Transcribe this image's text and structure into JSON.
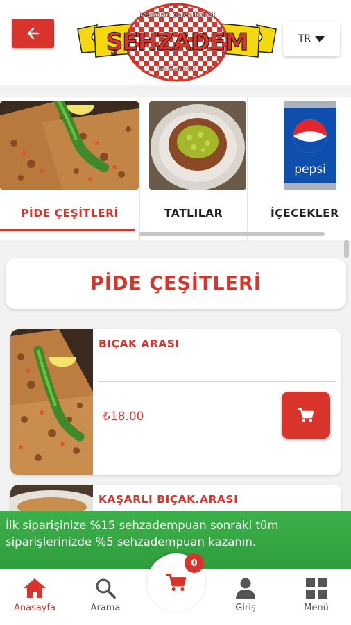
{
  "header": {
    "back_icon": "arrow-left-icon",
    "logo_tagline_top": "kaşından gelen lezzet",
    "logo_brand": "ŞEHZADEM",
    "logo_tagline_bottom": "balıkesir 2010",
    "language": "TR",
    "language_icon": "caret-down-icon"
  },
  "categories": [
    {
      "label": "PİDE ÇEŞİTLERİ",
      "active": true
    },
    {
      "label": "TATLILAR",
      "active": false
    },
    {
      "label": "İÇECEKLER",
      "active": false
    }
  ],
  "category_image_texts": {
    "pepsi": "pepsi"
  },
  "section": {
    "title": "PİDE ÇEŞİTLERİ"
  },
  "products": [
    {
      "name": "BIÇAK ARASI",
      "price": "₺18.00",
      "cart_icon": "cart-icon"
    },
    {
      "name": "KAŞARLI BIÇAK.ARASI",
      "price": "",
      "cart_icon": "cart-icon"
    }
  ],
  "promo": {
    "text": "İlk siparişinize %15 sehzadempuan sonraki tüm siparişlerinizde %5 sehzadempuan kazanın."
  },
  "cart": {
    "count": "0"
  },
  "bottom_nav": {
    "home": "Anasayfa",
    "search": "Arama",
    "login": "Giriş",
    "menu": "Menü"
  },
  "colors": {
    "accent": "#d9342b",
    "promo_green": "#35a644",
    "logo_yellow": "#f5d90f"
  }
}
